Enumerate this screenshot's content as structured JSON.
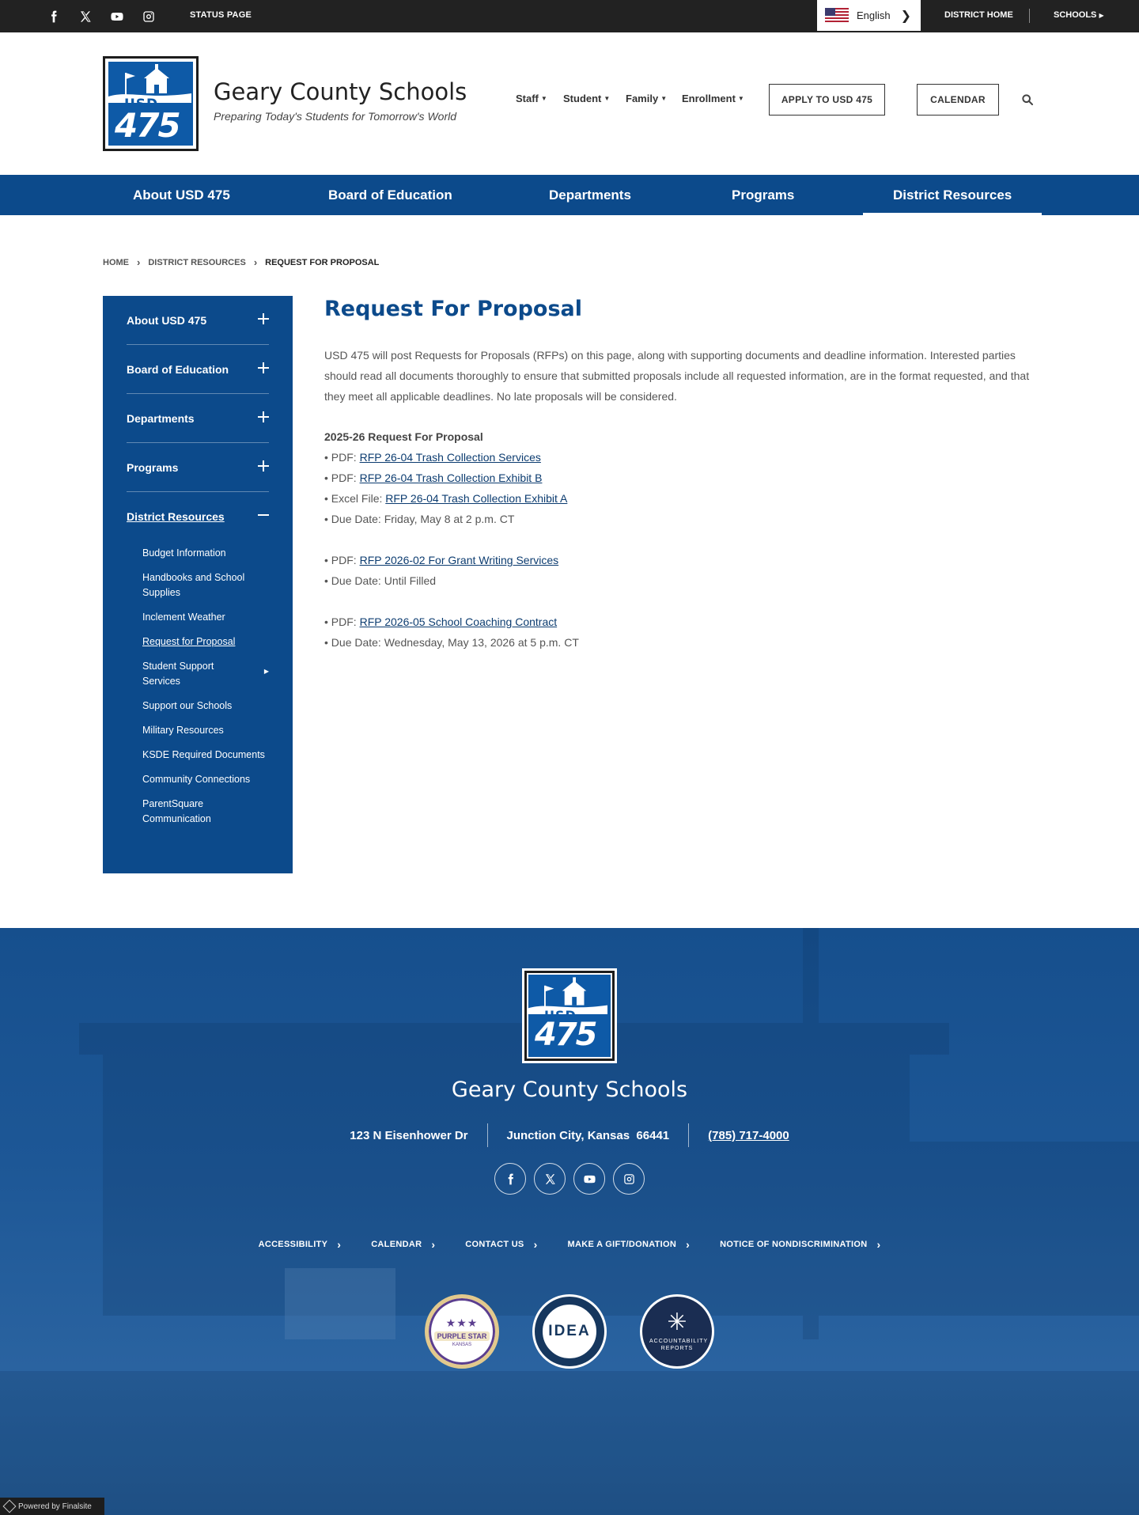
{
  "utility": {
    "social": [
      "facebook-icon",
      "x-icon",
      "youtube-icon",
      "instagram-icon"
    ],
    "status_page": "STATUS PAGE",
    "language": "English",
    "district_home": "DISTRICT HOME",
    "schools": "SCHOOLS"
  },
  "header": {
    "logo_text_top": "USD",
    "logo_text_bottom": "475",
    "site_name": "Geary County Schools",
    "tagline": "Preparing Today's Students for Tomorrow's World",
    "nav": [
      "Staff",
      "Student",
      "Family",
      "Enrollment"
    ],
    "apply_button": "APPLY TO USD 475",
    "calendar_button": "CALENDAR"
  },
  "main_nav": [
    "About USD 475",
    "Board of Education",
    "Departments",
    "Programs",
    "District Resources"
  ],
  "breadcrumb": {
    "home": "HOME",
    "section": "DISTRICT RESOURCES",
    "current": "REQUEST FOR PROPOSAL"
  },
  "sidebar": {
    "sections": [
      "About USD 475",
      "Board of Education",
      "Departments",
      "Programs"
    ],
    "open_section": "District Resources",
    "sub_items": [
      "Budget Information",
      "Handbooks and School Supplies",
      "Inclement Weather",
      "Request for Proposal",
      "Student Support Services",
      "Support our Schools",
      "Military Resources",
      "KSDE Required Documents",
      "Community Connections",
      "ParentSquare Communication"
    ]
  },
  "content": {
    "title": "Request For Proposal",
    "intro": "USD 475 will post Requests for Proposals (RFPs) on this page, along with supporting documents and deadline information. Interested parties should read all documents thoroughly to ensure that submitted proposals include all requested information, are in the format requested, and that they meet all applicable deadlines. No late proposals will be considered.",
    "section_heading": "2025-26 Request For Proposal",
    "group1": {
      "pdf1_prefix": "• PDF: ",
      "pdf1_link": "RFP 26-04 Trash Collection Services",
      "pdf2_prefix": "• PDF: ",
      "pdf2_link": "RFP 26-04 Trash Collection Exhibit B",
      "excel_prefix": "• Excel File: ",
      "excel_link": "RFP 26-04 Trash Collection Exhibit A",
      "due": "• Due Date: Friday, May 8 at 2 p.m. CT"
    },
    "group2": {
      "pdf_prefix": "• PDF: ",
      "pdf_link": "RFP 2026-02 For Grant Writing Services",
      "due": "• Due Date: Until Filled"
    },
    "group3": {
      "pdf_prefix": "• PDF: ",
      "pdf_link": "RFP 2026-05 School Coaching Contract",
      "due": "• Due Date: Wednesday, May 13, 2026 at 5 p.m. CT"
    }
  },
  "footer": {
    "site_name": "Geary County Schools",
    "address": "123 N Eisenhower Dr",
    "city": "Junction City, Kansas  66441",
    "phone": "(785) 717-4000",
    "links": [
      "ACCESSIBILITY",
      "CALENDAR",
      "CONTACT US",
      "MAKE A GIFT/DONATION",
      "NOTICE OF NONDISCRIMINATION"
    ],
    "badge1_stars": "★★★",
    "badge1_title": "PURPLE STAR",
    "badge1_sub": "KANSAS",
    "badge2_title": "IDEA",
    "badge3_title": "ACCOUNTABILITY REPORTS",
    "powered_by": "Powered by Finalsite"
  },
  "colors": {
    "brand_blue": "#0c4a8b",
    "link_blue": "#0c3c70",
    "utility_bar": "#222222"
  }
}
